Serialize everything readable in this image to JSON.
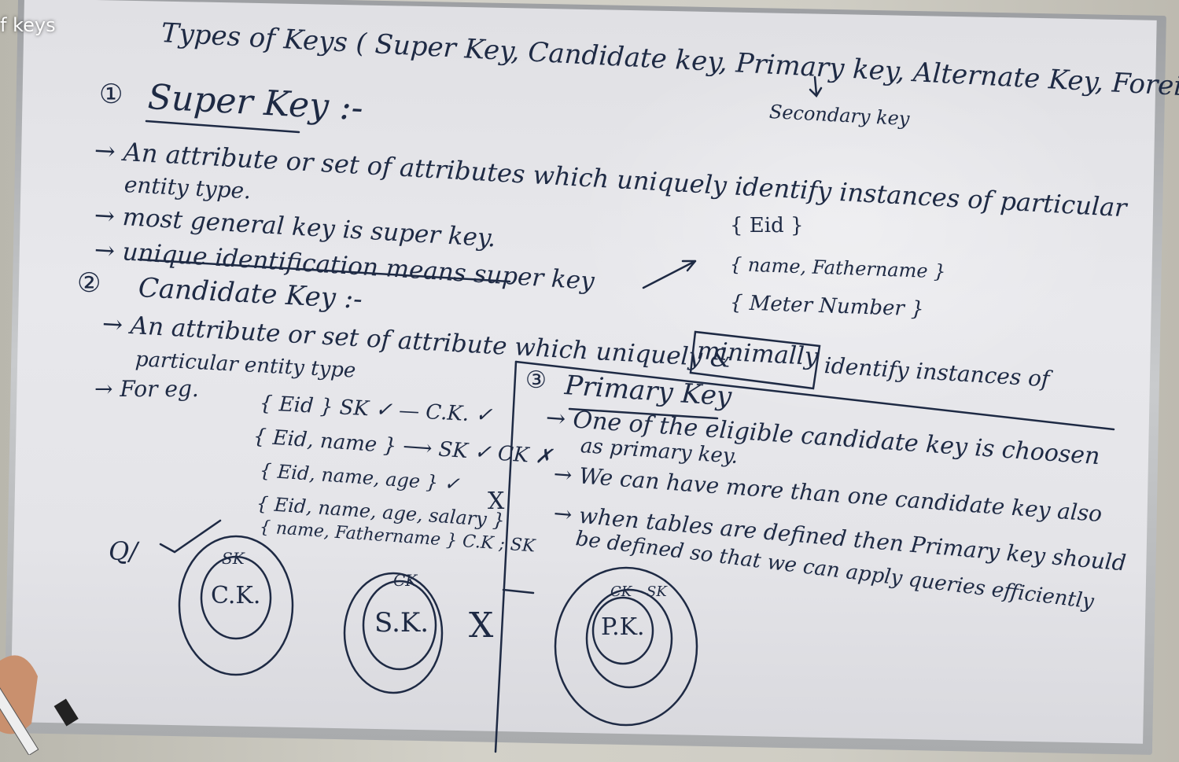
{
  "video": {
    "title_fragment": "f keys"
  },
  "board": {
    "title": "Types of Keys ( Super Key, Candidate key, Primary key, Alternate Key, Foreign key )",
    "secondary_note": "Secondary key",
    "super_key": {
      "number": "①",
      "heading": "Super Key :-",
      "line1": "→ An attribute or set of attributes which uniquely identify instances of particular",
      "line1b": "entity type.",
      "line2": "→ most general key is super key.",
      "line3": "→ unique identification means super key",
      "examples": [
        "{ Eid }",
        "{ name, Fathername }",
        "{ Meter Number }"
      ]
    },
    "candidate_key": {
      "number": "②",
      "heading": "Candidate Key :-",
      "line1_pre": "→ An attribute or set of attribute which uniquely &",
      "boxed_word": "minimally",
      "line1_post": "identify instances of",
      "line1b": "particular entity type",
      "for_eg": "→ For eg.",
      "examples": [
        "{ Eid }  SK ✓ — C.K. ✓",
        "{ Eid, name } ⟶ SK ✓ CK ✗",
        "{ Eid, name, age } ✓",
        "{ Eid, name, age, salary }",
        "{ name, Fathername } C.K ; SK"
      ],
      "mark_x": "X",
      "or_label": "Q/"
    },
    "primary_key": {
      "number": "③",
      "heading": "Primary Key",
      "line1": "→ One of the eligible candidate key is choosen",
      "line1b": "as primary key.",
      "line2": "→ We can have more than one candidate key also",
      "line3": "→ when tables are defined then Primary key should",
      "line3b": "be defined so that we can apply queries efficiently"
    },
    "diagrams": {
      "d1": {
        "outer": "SK",
        "inner": "C.K."
      },
      "d2": {
        "outer": "CK",
        "inner": "S.K.",
        "cross": "X"
      },
      "d3": {
        "outer": "SK",
        "middle": "CK",
        "inner": "P.K."
      }
    }
  }
}
